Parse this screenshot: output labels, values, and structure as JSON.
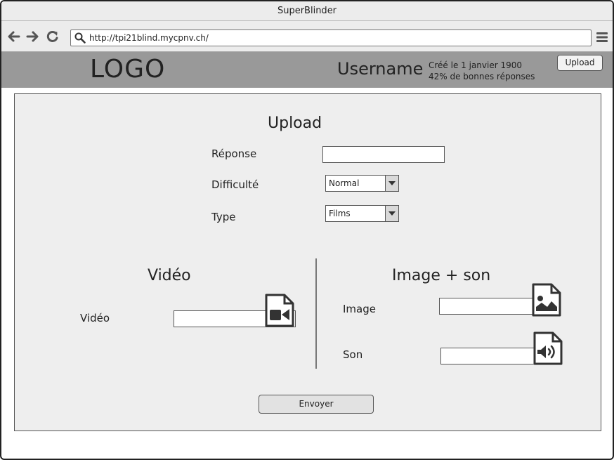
{
  "window": {
    "title": "SuperBlinder"
  },
  "browser": {
    "url": "http://tpi21blind.mycpnv.ch/",
    "icons": [
      "back-arrow-icon",
      "forward-arrow-icon",
      "reload-icon",
      "search-icon",
      "hamburger-menu-icon"
    ]
  },
  "header": {
    "logo": "LOGO",
    "username": "Username",
    "created": "Créé le 1 janvier 1900",
    "score": "42% de bonnes réponses",
    "upload_label": "Upload",
    "background_color": "#999999"
  },
  "form": {
    "title": "Upload",
    "answer_label": "Réponse",
    "answer_value": "",
    "difficulty_label": "Difficulté",
    "difficulty_value": "Normal",
    "type_label": "Type",
    "type_value": "Films"
  },
  "video_section": {
    "title": "Vidéo",
    "video_label": "Vidéo",
    "video_value": "",
    "icon": "video-file-icon"
  },
  "image_sound_section": {
    "title": "Image + son",
    "image_label": "Image",
    "image_value": "",
    "image_icon": "image-file-icon",
    "sound_label": "Son",
    "sound_value": "",
    "sound_icon": "audio-file-icon"
  },
  "submit_label": "Envoyer"
}
